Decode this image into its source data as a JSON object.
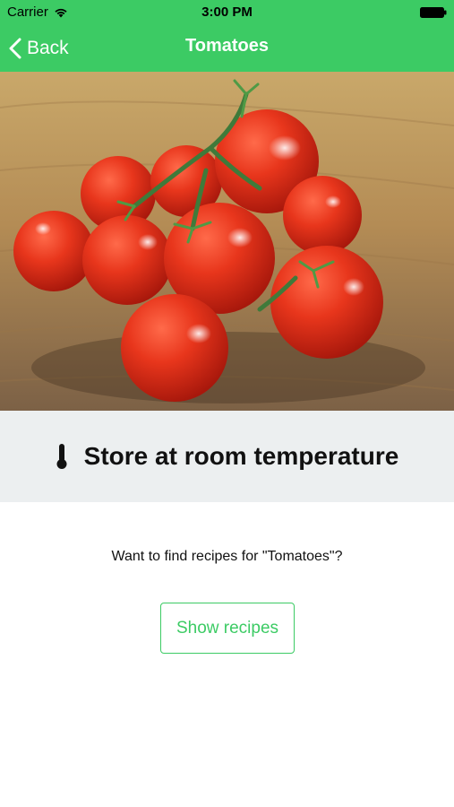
{
  "status_bar": {
    "carrier": "Carrier",
    "time": "3:00 PM"
  },
  "nav": {
    "back_label": "Back",
    "title": "Tomatoes"
  },
  "hero": {
    "image_alt": "Tomatoes"
  },
  "storage": {
    "icon": "thermometer-icon",
    "text": "Store at room temperature"
  },
  "recipes": {
    "question": "Want to find recipes for \"Tomatoes\"?",
    "button_label": "Show recipes"
  },
  "colors": {
    "accent": "#3ccb64",
    "banner_bg": "#eceff0"
  }
}
